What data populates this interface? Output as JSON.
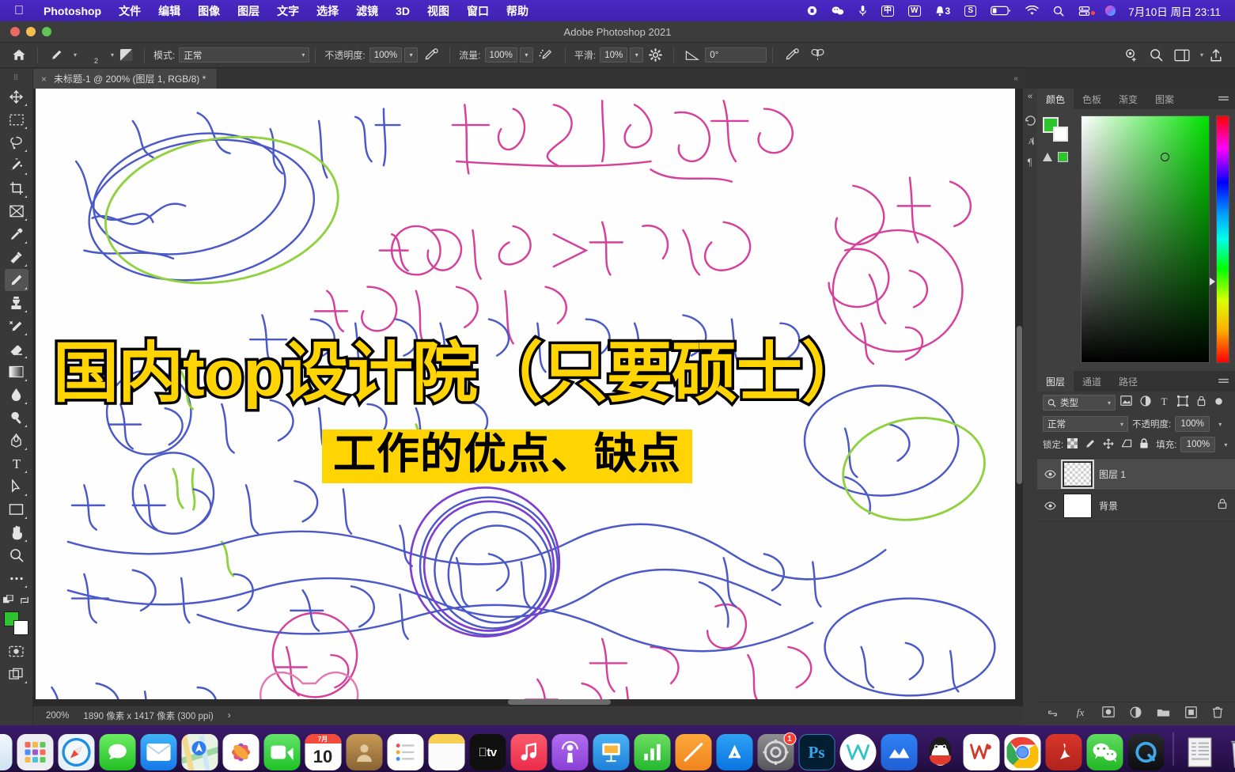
{
  "menubar": {
    "apple_icon": "apple-logo",
    "app": "Photoshop",
    "items": [
      "文件",
      "编辑",
      "图像",
      "图层",
      "文字",
      "选择",
      "滤镜",
      "3D",
      "视图",
      "窗口",
      "帮助"
    ],
    "status_icons": [
      {
        "name": "screen-record-icon",
        "glyph": "⬤"
      },
      {
        "name": "wechat-devtool-icon",
        "glyph": "◕"
      },
      {
        "name": "microphone-icon",
        "glyph": "🎤"
      },
      {
        "name": "input-method-chinese-icon",
        "glyph": "中"
      },
      {
        "name": "wps-icon",
        "glyph": "W"
      },
      {
        "name": "notification-bell-icon",
        "glyph": "🔔",
        "badge": "3"
      },
      {
        "name": "sogou-icon",
        "glyph": "S"
      },
      {
        "name": "battery-icon",
        "glyph": "battery"
      },
      {
        "name": "wifi-icon",
        "glyph": "wifi"
      },
      {
        "name": "spotlight-search-icon",
        "glyph": "search"
      },
      {
        "name": "control-center-icon",
        "glyph": "controls"
      },
      {
        "name": "siri-icon",
        "glyph": "siri"
      }
    ],
    "clock": "7月10日 周日 23:11"
  },
  "window": {
    "title": "Adobe Photoshop 2021",
    "traffic_lights": [
      "close",
      "minimize",
      "zoom"
    ]
  },
  "options_bar": {
    "home_icon": "home-icon",
    "brush_preview_icon": "brush-preset-icon",
    "brush_size": "2",
    "brush_panel_icon": "brush-settings-panel-icon",
    "mode_label": "模式:",
    "mode_value": "正常",
    "opacity_label": "不透明度:",
    "opacity_value": "100%",
    "pressure_opacity_icon": "pressure-controls-opacity-icon",
    "flow_label": "流量:",
    "flow_value": "100%",
    "airbrush_icon": "airbrush-icon",
    "smoothing_label": "平滑:",
    "smoothing_value": "10%",
    "smoothing_options_icon": "gear-icon",
    "angle_icon": "brush-angle-icon",
    "angle_value": "0°",
    "pressure_size_icon": "pressure-controls-size-icon",
    "symmetry_icon": "symmetry-butterfly-icon",
    "right_icons": [
      {
        "name": "share-to-cloud-icon"
      },
      {
        "name": "search-icon"
      },
      {
        "name": "workspace-switcher-icon"
      },
      {
        "name": "share-export-icon"
      }
    ]
  },
  "toolbar": {
    "tools": [
      {
        "name": "move-tool",
        "label": "移动工具",
        "selected": false
      },
      {
        "name": "marquee-tool",
        "label": "矩形选框工具",
        "selected": false
      },
      {
        "name": "lasso-tool",
        "label": "套索工具",
        "selected": false
      },
      {
        "name": "quick-selection-tool",
        "label": "快速选择工具",
        "selected": false
      },
      {
        "name": "crop-tool",
        "label": "裁剪工具",
        "selected": false
      },
      {
        "name": "frame-tool",
        "label": "画框工具",
        "selected": false
      },
      {
        "name": "eyedropper-tool",
        "label": "吸管工具",
        "selected": false
      },
      {
        "name": "healing-brush-tool",
        "label": "污点修复画笔工具",
        "selected": false
      },
      {
        "name": "brush-tool",
        "label": "画笔工具",
        "selected": true
      },
      {
        "name": "clone-stamp-tool",
        "label": "仿制图章工具",
        "selected": false
      },
      {
        "name": "history-brush-tool",
        "label": "历史记录画笔工具",
        "selected": false
      },
      {
        "name": "eraser-tool",
        "label": "橡皮擦工具",
        "selected": false
      },
      {
        "name": "gradient-tool",
        "label": "渐变工具",
        "selected": false
      },
      {
        "name": "blur-tool",
        "label": "模糊工具",
        "selected": false
      },
      {
        "name": "dodge-tool",
        "label": "减淡工具",
        "selected": false
      },
      {
        "name": "pen-tool",
        "label": "钢笔工具",
        "selected": false
      },
      {
        "name": "type-tool",
        "label": "横排文字工具",
        "selected": false
      },
      {
        "name": "path-selection-tool",
        "label": "路径选择工具",
        "selected": false
      },
      {
        "name": "rectangle-tool",
        "label": "矩形工具",
        "selected": false
      },
      {
        "name": "hand-tool",
        "label": "抓手工具",
        "selected": false
      },
      {
        "name": "zoom-tool",
        "label": "缩放工具",
        "selected": false
      },
      {
        "name": "edit-toolbar-tool",
        "label": "编辑工具栏",
        "selected": false
      }
    ],
    "quick_mask_icon": "quick-mask-icon",
    "screen-mode-icon": "screen-mode-icon",
    "foreground_color": "#2dc42d",
    "background_color": "#ffffff"
  },
  "document": {
    "tab_close_icon": "close-icon",
    "tab_title": "未标题-1 @ 200% (图层 1, RGB/8) *"
  },
  "status": {
    "zoom": "200%",
    "dimensions": "1890 像素 x 1417 像素 (300 ppi)",
    "arrow": "›"
  },
  "overlay": {
    "title": "国内top设计院（只要硕士）",
    "subtitle": "工作的优点、缺点",
    "title_color": "#FFD400",
    "title_stroke": "#000000",
    "subtitle_bg": "#FFD400",
    "subtitle_color": "#000000"
  },
  "color_panel": {
    "tabs": [
      {
        "label": "颜色",
        "active": true
      },
      {
        "label": "色板",
        "active": false
      },
      {
        "label": "渐变",
        "active": false
      },
      {
        "label": "图案",
        "active": false
      }
    ],
    "menu_icon": "panel-menu-icon",
    "foreground": "#2dc42d",
    "background": "#ffffff",
    "out-of-gamut_icon": "gamut-warning-icon"
  },
  "layers_panel": {
    "tabs": [
      {
        "label": "图层",
        "active": true
      },
      {
        "label": "通道",
        "active": false
      },
      {
        "label": "路径",
        "active": false
      }
    ],
    "menu_icon": "panel-menu-icon",
    "filter_label": "类型",
    "filter_icons": [
      {
        "name": "filter-pixel-icon"
      },
      {
        "name": "filter-adjustment-icon"
      },
      {
        "name": "filter-type-icon"
      },
      {
        "name": "filter-shape-icon"
      },
      {
        "name": "filter-smart-object-icon"
      },
      {
        "name": "filter-toggle-icon"
      }
    ],
    "blend_mode": "正常",
    "opacity_label": "不透明度:",
    "opacity_value": "100%",
    "lock_label": "锁定:",
    "lock_icons": [
      {
        "name": "lock-transparent-pixels-icon"
      },
      {
        "name": "lock-image-pixels-icon"
      },
      {
        "name": "lock-position-icon"
      },
      {
        "name": "lock-artboard-nesting-icon"
      },
      {
        "name": "lock-all-icon"
      }
    ],
    "fill_label": "填充:",
    "fill_value": "100%",
    "layers": [
      {
        "name": "图层 1",
        "visible": true,
        "selected": true,
        "locked": false,
        "thumb": "transparent"
      },
      {
        "name": "背景",
        "visible": true,
        "selected": false,
        "locked": true,
        "thumb": "white"
      }
    ],
    "bottom_icons": [
      {
        "name": "link-layers-icon"
      },
      {
        "name": "layer-style-fx-icon"
      },
      {
        "name": "add-layer-mask-icon"
      },
      {
        "name": "new-adjustment-layer-icon"
      },
      {
        "name": "new-group-icon"
      },
      {
        "name": "new-layer-icon"
      },
      {
        "name": "delete-layer-icon"
      }
    ]
  },
  "rail": {
    "icons": [
      {
        "name": "collapse-panels-icon"
      },
      {
        "name": "history-panel-icon"
      },
      {
        "name": "character-panel-icon"
      },
      {
        "name": "paragraph-panel-icon"
      }
    ]
  },
  "dock": {
    "items": [
      {
        "name": "finder",
        "label": "访达",
        "running": true
      },
      {
        "name": "launchpad",
        "label": "启动台",
        "running": false
      },
      {
        "name": "safari",
        "label": "Safari",
        "running": false
      },
      {
        "name": "messages",
        "label": "信息",
        "running": false
      },
      {
        "name": "mail",
        "label": "邮件",
        "running": false
      },
      {
        "name": "maps",
        "label": "地图",
        "running": false
      },
      {
        "name": "photos",
        "label": "照片",
        "running": false
      },
      {
        "name": "facetime",
        "label": "FaceTime",
        "running": false
      },
      {
        "name": "calendar",
        "label": "日历",
        "running": false,
        "day": "10",
        "month": "7月"
      },
      {
        "name": "contacts",
        "label": "通讯录",
        "running": false
      },
      {
        "name": "reminders",
        "label": "提醒事项",
        "running": false
      },
      {
        "name": "notes",
        "label": "备忘录",
        "running": false
      },
      {
        "name": "appletv",
        "label": "Apple TV",
        "running": false
      },
      {
        "name": "music",
        "label": "音乐",
        "running": false
      },
      {
        "name": "podcasts",
        "label": "播客",
        "running": false
      },
      {
        "name": "keynote",
        "label": "Keynote",
        "running": false
      },
      {
        "name": "numbers",
        "label": "Numbers",
        "running": false
      },
      {
        "name": "pages",
        "label": "Pages",
        "running": false
      },
      {
        "name": "appstore",
        "label": "App Store",
        "running": false
      },
      {
        "name": "system-preferences",
        "label": "系统偏好设置",
        "running": true,
        "badge": "1"
      },
      {
        "name": "photoshop",
        "label": "Photoshop",
        "running": true
      },
      {
        "name": "youdao",
        "label": "有道",
        "running": true
      },
      {
        "name": "mindmaster",
        "label": "MindMaster",
        "running": true
      },
      {
        "name": "qq",
        "label": "QQ",
        "running": true
      },
      {
        "name": "wps",
        "label": "WPS Office",
        "running": true
      },
      {
        "name": "chrome",
        "label": "Google Chrome",
        "running": true
      },
      {
        "name": "acrobat",
        "label": "Adobe Acrobat",
        "running": true
      },
      {
        "name": "wechat",
        "label": "微信",
        "running": true
      },
      {
        "name": "quicktime",
        "label": "QuickTime Player",
        "running": true
      },
      {
        "name": "downloads-stack",
        "label": "下载",
        "running": false
      },
      {
        "name": "trash",
        "label": "废纸篓",
        "running": false
      }
    ]
  }
}
